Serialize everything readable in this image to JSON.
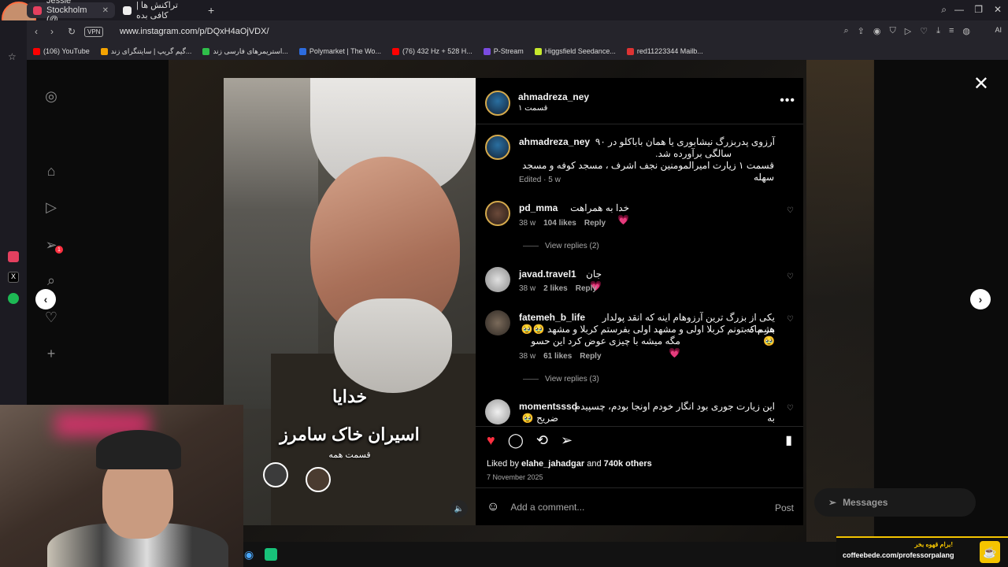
{
  "browser": {
    "tabs": [
      {
        "title": "Jessie Stockholm (@",
        "active": true
      },
      {
        "title": "تراکنش ها | کافی بده",
        "active": false
      }
    ],
    "url": "www.instagram.com/p/DQxH4aOjVDX/",
    "vpn_label": "VPN",
    "ai_label": "AI",
    "bookmarks": [
      {
        "label": "(106) YouTube",
        "color": "#ff0000"
      },
      {
        "label": "گیم گریپ | سایتنگرای زند...",
        "color": "#f4a300"
      },
      {
        "label": "استریمرهای فارسی زند...",
        "color": "#2fbf4a"
      },
      {
        "label": "Polymarket | The Wo...",
        "color": "#2d6cdf"
      },
      {
        "label": "(76) 432 Hz + 528 H...",
        "color": "#ff0000"
      },
      {
        "label": "P-Stream",
        "color": "#7a4be0"
      },
      {
        "label": "Higgsfield Seedance...",
        "color": "#c6e82d"
      },
      {
        "label": "red11223344 Mailb...",
        "color": "#d33"
      }
    ]
  },
  "ig": {
    "sidebar_notif_count": "1",
    "post": {
      "author": "ahmadreza_ney",
      "subtitle": "قسمت ۱",
      "caption_user": "ahmadreza_ney",
      "caption_lines": [
        "آرزوی پدربزرگ نیشابوری یا همان باباکلو در ۹۰",
        "سالگی برآورده شد.",
        "قسمت ۱ زیارت امیرالمومنین نجف اشرف ، مسجد کوفه و مسجد سهله"
      ],
      "caption_meta": "Edited · 5 w",
      "video_caption_1": "خدایا",
      "video_caption_2": "اسیران خاک سامرز",
      "video_caption_3": "قسمت همه",
      "comments": [
        {
          "user": "pd_mma",
          "text": "خدا به همراهت 💗",
          "age": "38 w",
          "likes": "104 likes",
          "reply": "Reply",
          "view_replies": "View replies (2)"
        },
        {
          "user": "javad.travel1",
          "text": "جان 💗",
          "age": "38 w",
          "likes": "2 likes",
          "reply": "Reply",
          "view_replies": ""
        },
        {
          "user": "fatemeh_b_life",
          "text_lines": [
            "یکی از بزرگ ترین آرزوهام اینه که انقد پولدار بشم که",
            "هر ماه بتونم کربلا اولی و مشهد اولی بفرستم کربلا و مشهد 🥹🥹🥹",
            "مگه میشه با چیزی عوض کرد این حسو 💗"
          ],
          "age": "38 w",
          "likes": "61 likes",
          "reply": "Reply",
          "view_replies": "View replies (3)"
        },
        {
          "user": "momentsssd",
          "text_lines": [
            "این زیارت جوری بود انگار خودم اونجا بودم، چسپیدم به",
            "ضریح 🥹"
          ]
        }
      ],
      "liked_by_prefix": "Liked by",
      "liked_by_user": "elahe_jahadgar",
      "liked_and": "and",
      "liked_others": "740k others",
      "date": "7 November 2025",
      "comment_placeholder": "Add a comment...",
      "post_label": "Post"
    },
    "messages_label": "Messages"
  },
  "overlay": {
    "coffee_title": "برام قهوه بخر!",
    "coffee_url": "coffeebede.com/professorpalang"
  }
}
